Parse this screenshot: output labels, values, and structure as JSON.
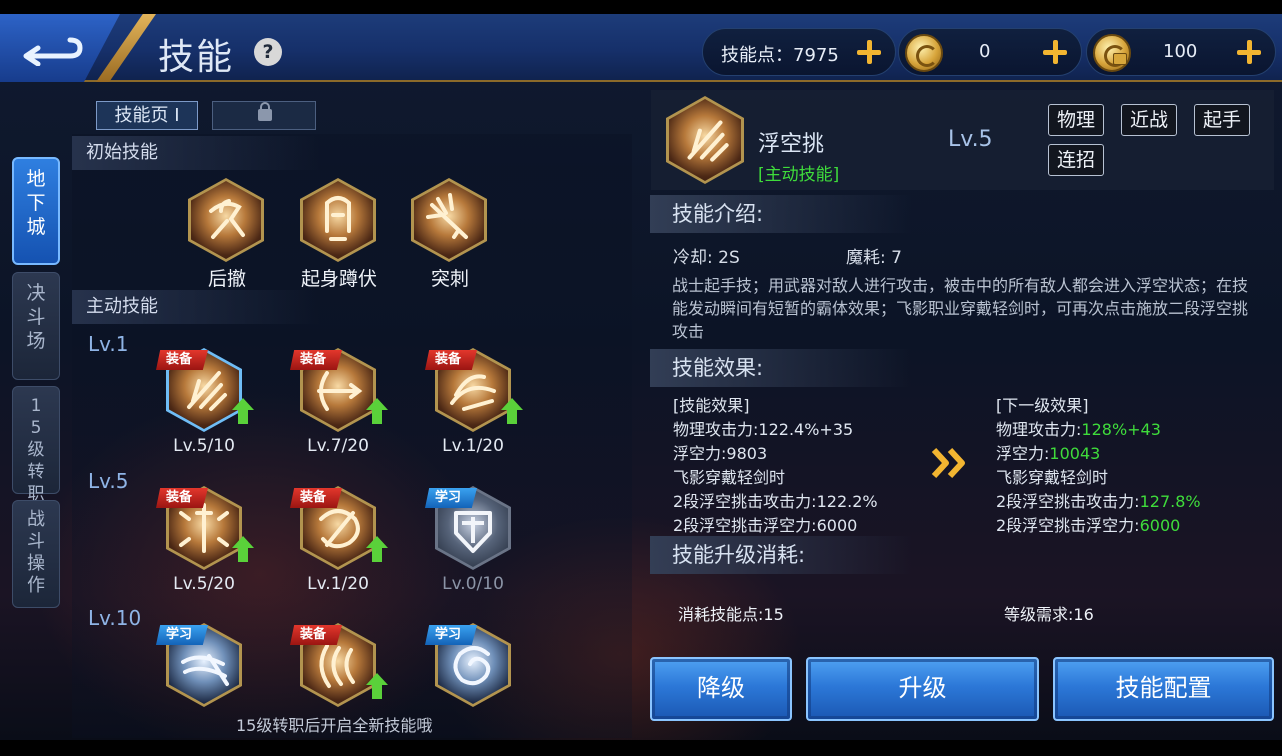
{
  "header": {
    "title": "技能",
    "help_icon": "question-mark-icon",
    "resources": [
      {
        "label": "技能点：7975",
        "icon": "none"
      },
      {
        "label": "0",
        "icon": "gold-coin-icon"
      },
      {
        "label": "100",
        "icon": "locked-gold-coin-icon"
      }
    ]
  },
  "side_tabs": [
    {
      "label": "地下城",
      "active": true
    },
    {
      "label": "决斗场",
      "active": false
    },
    {
      "label": "15级转职",
      "active": false
    },
    {
      "label": "战斗操作",
      "active": false
    }
  ],
  "skill_pages": {
    "page1": "技能页 I"
  },
  "sections": {
    "initial": "初始技能",
    "active": "主动技能"
  },
  "basic_skills": [
    {
      "name": "后撤"
    },
    {
      "name": "起身蹲伏"
    },
    {
      "name": "突刺"
    }
  ],
  "level_rows": [
    "Lv.1",
    "Lv.5",
    "Lv.10"
  ],
  "active_skills": [
    {
      "badge": "装备",
      "badge_type": "equip",
      "level": "Lv.5/10",
      "upgradable": true,
      "selected": true
    },
    {
      "badge": "装备",
      "badge_type": "equip",
      "level": "Lv.7/20",
      "upgradable": true
    },
    {
      "badge": "装备",
      "badge_type": "equip",
      "level": "Lv.1/20",
      "upgradable": true
    },
    {
      "badge": "装备",
      "badge_type": "equip",
      "level": "Lv.5/20",
      "upgradable": true
    },
    {
      "badge": "装备",
      "badge_type": "equip",
      "level": "Lv.1/20",
      "upgradable": true
    },
    {
      "badge": "学习",
      "badge_type": "learn",
      "level": "Lv.0/10",
      "upgradable": false
    },
    {
      "badge": "学习",
      "badge_type": "learn",
      "level": "",
      "upgradable": false
    },
    {
      "badge": "装备",
      "badge_type": "equip",
      "level": "",
      "upgradable": true
    },
    {
      "badge": "学习",
      "badge_type": "learn",
      "level": "",
      "upgradable": false
    }
  ],
  "bottom_hint": "15级转职后开启全新技能哦",
  "detail": {
    "name": "浮空挑",
    "type": "[主动技能]",
    "level": "Lv.5",
    "tags": [
      "物理",
      "近战",
      "起手",
      "连招"
    ],
    "intro_title": "技能介绍:",
    "cooldown": "冷却: 2S",
    "mana": "魔耗: 7",
    "description": "战士起手技；用武器对敌人进行攻击，被击中的所有敌人都会进入浮空状态；在技能发动瞬间有短暂的霸体效果；飞影职业穿戴轻剑时，可再次点击施放二段浮空挑攻击",
    "effect_title": "技能效果:",
    "current": {
      "header": "[技能效果]",
      "lines": [
        {
          "label": "物理攻击力:",
          "value": "122.4%+35"
        },
        {
          "label": "浮空力:",
          "value": "9803"
        },
        {
          "label": "飞影穿戴轻剑时",
          "value": ""
        },
        {
          "label": "2段浮空挑击攻击力:",
          "value": "122.2%"
        },
        {
          "label": "2段浮空挑击浮空力:",
          "value": "6000"
        }
      ]
    },
    "next": {
      "header": "[下一级效果]",
      "lines": [
        {
          "label": "物理攻击力:",
          "value": "128%+43"
        },
        {
          "label": "浮空力:",
          "value": "10043"
        },
        {
          "label": "飞影穿戴轻剑时",
          "value": ""
        },
        {
          "label": "2段浮空挑击攻击力:",
          "value": "127.8%"
        },
        {
          "label": "2段浮空挑击浮空力:",
          "value": "6000"
        }
      ]
    },
    "cost_title": "技能升级消耗:",
    "cost_points": "消耗技能点:15",
    "level_req": "等级需求:16"
  },
  "buttons": {
    "downgrade": "降级",
    "upgrade": "升级",
    "config": "技能配置"
  },
  "colors": {
    "accent_blue": "#2c78d8",
    "gold": "#f2b531",
    "green_value": "#3fdc3b",
    "equip_badge": "#e3372c",
    "learn_badge": "#3aa2f0"
  }
}
